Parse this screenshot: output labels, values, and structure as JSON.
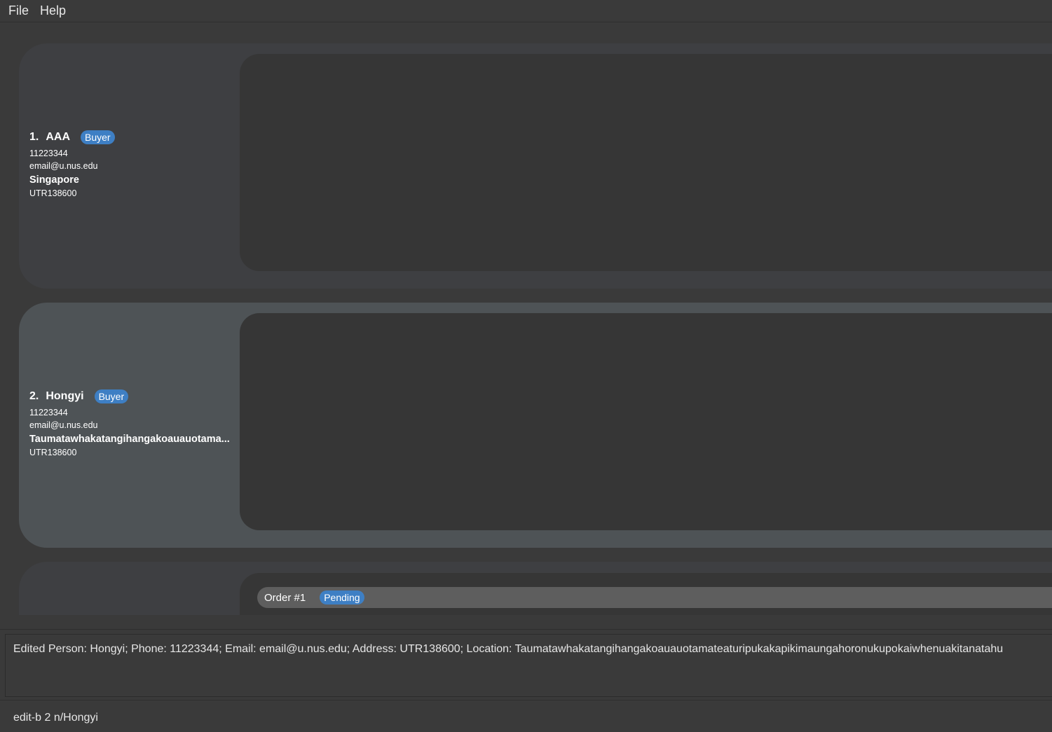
{
  "menu": {
    "file": "File",
    "help": "Help"
  },
  "persons": [
    {
      "index": "1.",
      "name": "AAA",
      "tag": "Buyer",
      "phone": "11223344",
      "email": "email@u.nus.edu",
      "location": "Singapore",
      "address": "UTR138600"
    },
    {
      "index": "2.",
      "name": "Hongyi",
      "tag": "Buyer",
      "phone": "11223344",
      "email": "email@u.nus.edu",
      "location": "Taumatawhakatangihangakoauauotama...",
      "address": "UTR138600"
    }
  ],
  "orders": [
    {
      "label": "Order #1",
      "status": "Pending"
    }
  ],
  "result": "Edited Person: Hongyi; Phone: 11223344; Email: email@u.nus.edu; Address: UTR138600; Location: Taumatawhakatangihangakoauauotamateaturipukakapikimaungahoronukupokaiwhenuakitanatahu",
  "command": "edit-b 2 n/Hongyi",
  "colors": {
    "tag": "#3e7fc4",
    "background": "#3a3a3a"
  }
}
